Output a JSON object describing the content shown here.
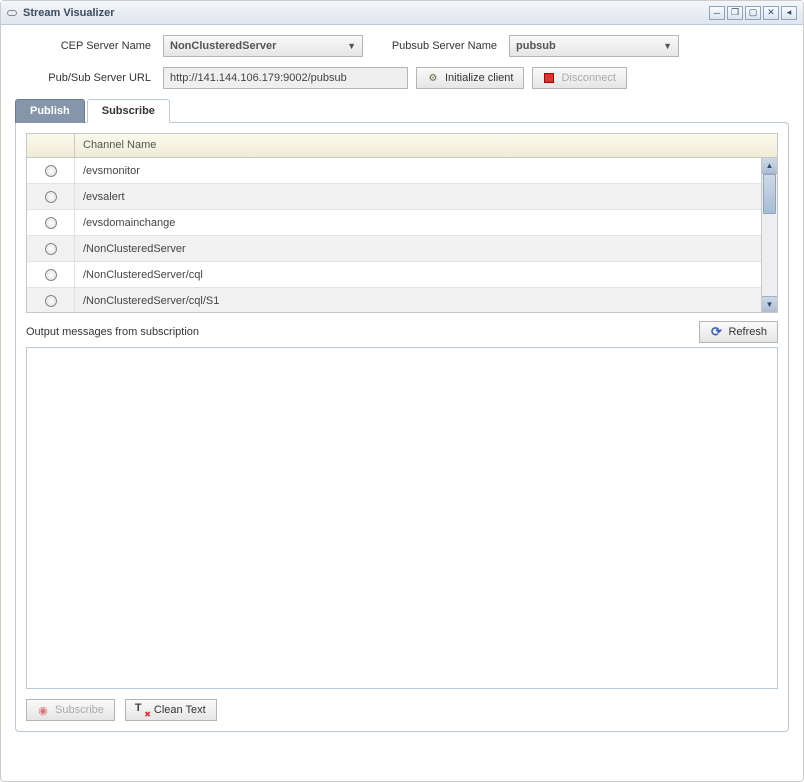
{
  "window": {
    "title": "Stream Visualizer"
  },
  "form": {
    "cep_label": "CEP Server Name",
    "cep_value": "NonClusteredServer",
    "pubsub_label": "Pubsub Server Name",
    "pubsub_value": "pubsub",
    "url_label": "Pub/Sub Server URL",
    "url_value": "http://141.144.106.179:9002/pubsub",
    "init_label": "Initialize client",
    "disconnect_label": "Disconnect"
  },
  "tabs": {
    "publish": "Publish",
    "subscribe": "Subscribe"
  },
  "grid": {
    "header": "Channel Name",
    "rows": [
      "/evsmonitor",
      "/evsalert",
      "/evsdomainchange",
      "/NonClusteredServer",
      "/NonClusteredServer/cql",
      "/NonClusteredServer/cql/S1"
    ]
  },
  "output": {
    "label": "Output messages from subscription",
    "refresh": "Refresh"
  },
  "buttons": {
    "subscribe": "Subscribe",
    "clean": "Clean Text"
  }
}
